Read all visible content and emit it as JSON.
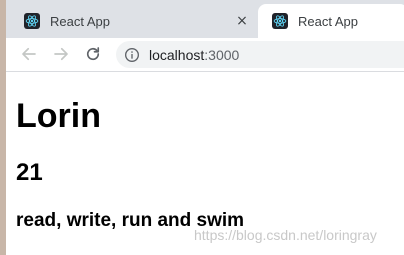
{
  "browser": {
    "tabs": [
      {
        "title": "React App",
        "icon": "react-logo-icon",
        "active": false,
        "close_label": "×"
      },
      {
        "title": "React App",
        "icon": "react-logo-icon",
        "active": true
      }
    ],
    "toolbar": {
      "back_icon": "arrow-left-icon",
      "forward_icon": "arrow-right-icon",
      "reload_icon": "reload-icon",
      "site_info_icon": "info-icon",
      "url_host": "localhost",
      "url_port": ":3000"
    }
  },
  "page": {
    "name": "Lorin",
    "age": "21",
    "hobbies": "read, write, run and swim"
  },
  "watermark": "https://blog.csdn.net/loringray",
  "colors": {
    "tabbar": "#dee1e6",
    "omnibox": "#f1f3f4",
    "react_bg": "#20232a",
    "react_accent": "#61dafb"
  }
}
